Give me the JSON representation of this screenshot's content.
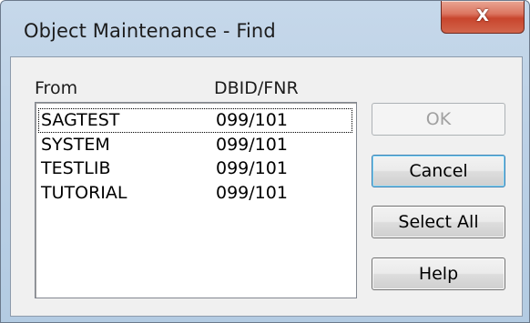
{
  "window": {
    "title": "Object Maintenance - Find",
    "close_glyph": "X"
  },
  "list": {
    "headers": {
      "from": "From",
      "dbid": "DBID/FNR"
    },
    "rows": [
      {
        "from": "SAGTEST",
        "dbid": "099/101"
      },
      {
        "from": "SYSTEM",
        "dbid": "099/101"
      },
      {
        "from": "TESTLIB",
        "dbid": "099/101"
      },
      {
        "from": "TUTORIAL",
        "dbid": "099/101"
      }
    ]
  },
  "buttons": {
    "ok": "OK",
    "cancel": "Cancel",
    "select_all": "Select All",
    "help": "Help"
  }
}
